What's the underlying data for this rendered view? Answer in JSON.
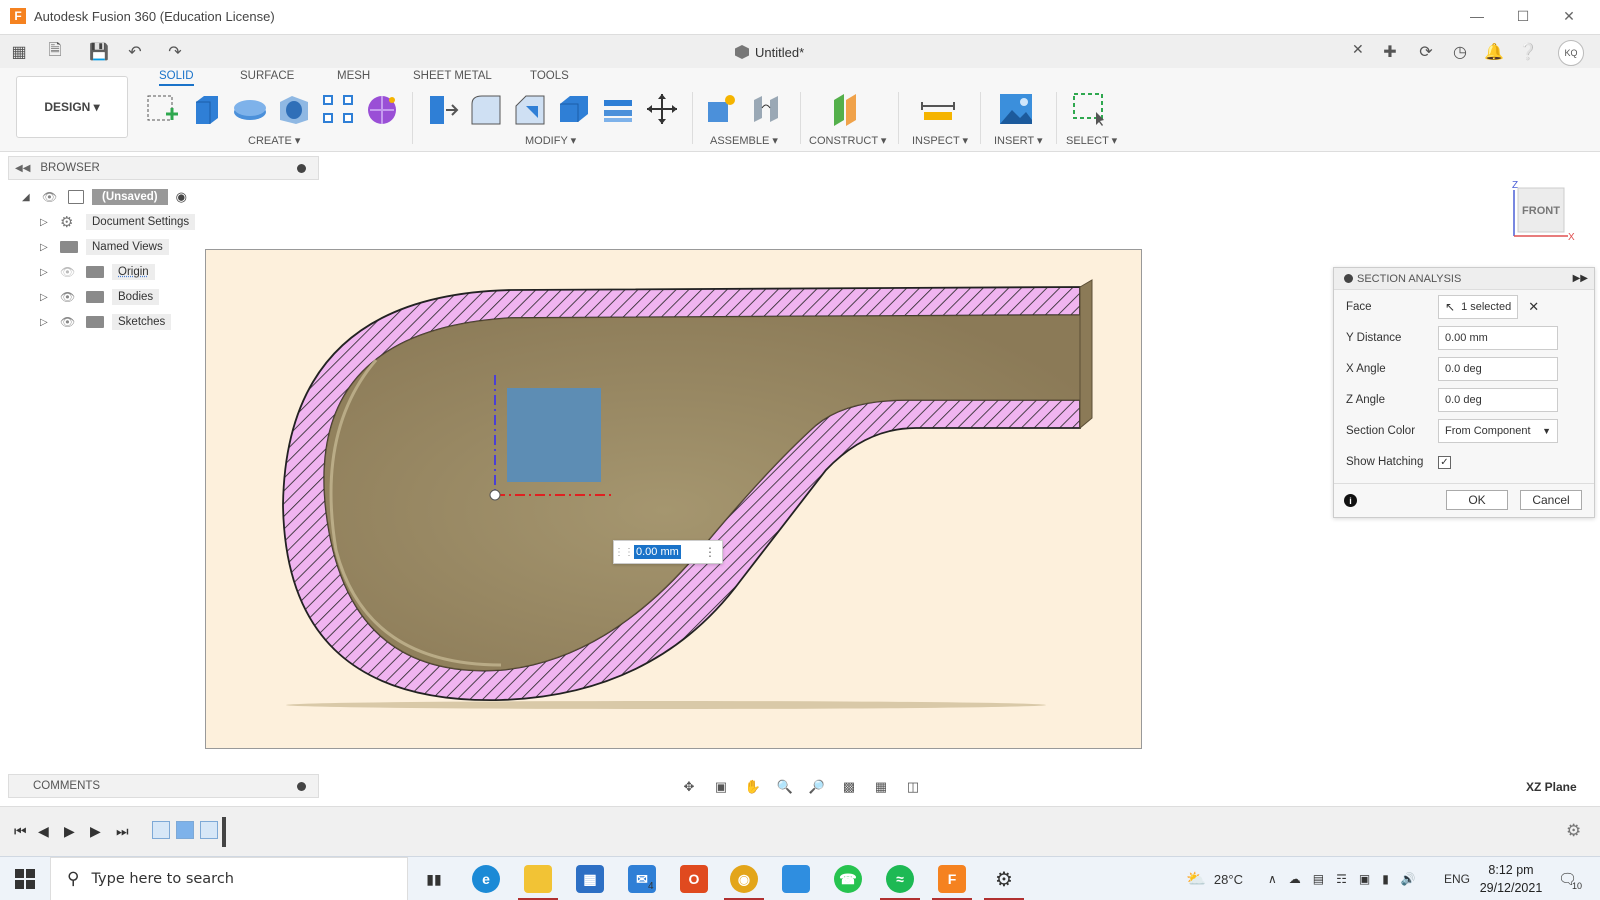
{
  "window": {
    "title": "Autodesk Fusion 360 (Education License)",
    "app_icon_letter": "F"
  },
  "quick_access": {
    "document_title": "Untitled*"
  },
  "user": {
    "initials": "KQ"
  },
  "ribbon": {
    "workspace_button": "DESIGN ▾",
    "tabs": [
      {
        "label": "SOLID",
        "active": true
      },
      {
        "label": "SURFACE",
        "active": false
      },
      {
        "label": "MESH",
        "active": false
      },
      {
        "label": "SHEET METAL",
        "active": false
      },
      {
        "label": "TOOLS",
        "active": false
      }
    ],
    "groups": {
      "create": "CREATE ▾",
      "modify": "MODIFY ▾",
      "assemble": "ASSEMBLE ▾",
      "construct": "CONSTRUCT ▾",
      "inspect": "INSPECT ▾",
      "insert": "INSERT ▾",
      "select": "SELECT ▾"
    }
  },
  "browser": {
    "title": "BROWSER",
    "root": "(Unsaved)",
    "items": [
      {
        "label": "Document Settings",
        "icon": "gear-icon"
      },
      {
        "label": "Named Views",
        "icon": "folder-icon"
      },
      {
        "label": "Origin",
        "icon": "folder-icon"
      },
      {
        "label": "Bodies",
        "icon": "folder-icon"
      },
      {
        "label": "Sketches",
        "icon": "folder-icon"
      }
    ]
  },
  "viewcube": {
    "face": "FRONT",
    "axis_z": "Z",
    "axis_x": "X"
  },
  "dimension_input": {
    "value": "0.00 mm"
  },
  "section_analysis": {
    "title": "SECTION ANALYSIS",
    "face_label": "Face",
    "face_value": "1 selected",
    "y_distance_label": "Y Distance",
    "y_distance_value": "0.00 mm",
    "x_angle_label": "X Angle",
    "x_angle_value": "0.0 deg",
    "z_angle_label": "Z Angle",
    "z_angle_value": "0.0 deg",
    "section_color_label": "Section Color",
    "section_color_value": "From Component",
    "show_hatching_label": "Show Hatching",
    "show_hatching_checked": true,
    "ok_label": "OK",
    "cancel_label": "Cancel"
  },
  "comments": {
    "title": "COMMENTS"
  },
  "plane_label": "XZ Plane",
  "taskbar": {
    "search_placeholder": "Type here to search",
    "temperature": "28°C",
    "language": "ENG",
    "time": "8:12 pm",
    "date": "29/12/2021",
    "notification_count": "10",
    "mail_badge": "4"
  },
  "colors": {
    "accent": "#1a73c9",
    "viewport_bg": "#fdf0dc",
    "body_fill": "#9a8a6c",
    "hatch": "#f0b4f0"
  }
}
